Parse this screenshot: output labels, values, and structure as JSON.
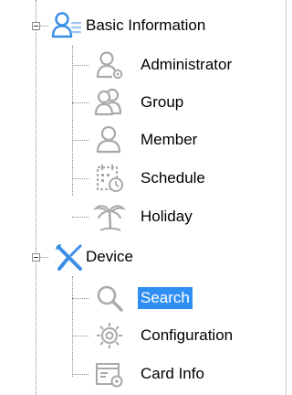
{
  "tree": {
    "basic_information": {
      "label": "Basic Information",
      "expanded": true,
      "icon": "users-list-icon",
      "children": [
        {
          "label": "Administrator",
          "icon": "admin-user-gear-icon"
        },
        {
          "label": "Group",
          "icon": "group-users-icon"
        },
        {
          "label": "Member",
          "icon": "member-user-icon"
        },
        {
          "label": "Schedule",
          "icon": "calendar-clock-icon"
        },
        {
          "label": "Holiday",
          "icon": "palm-tree-icon"
        }
      ]
    },
    "device": {
      "label": "Device",
      "expanded": true,
      "icon": "tools-icon",
      "children": [
        {
          "label": "Search",
          "icon": "magnifier-icon",
          "selected": true
        },
        {
          "label": "Configuration",
          "icon": "gear-icon"
        },
        {
          "label": "Card Info",
          "icon": "card-gear-icon"
        }
      ]
    }
  },
  "colors": {
    "selection": "#2f8ef2",
    "accent_blue": "#3a8ee6",
    "icon_gray": "#a9a9a9",
    "connector": "#8a8a8a"
  }
}
